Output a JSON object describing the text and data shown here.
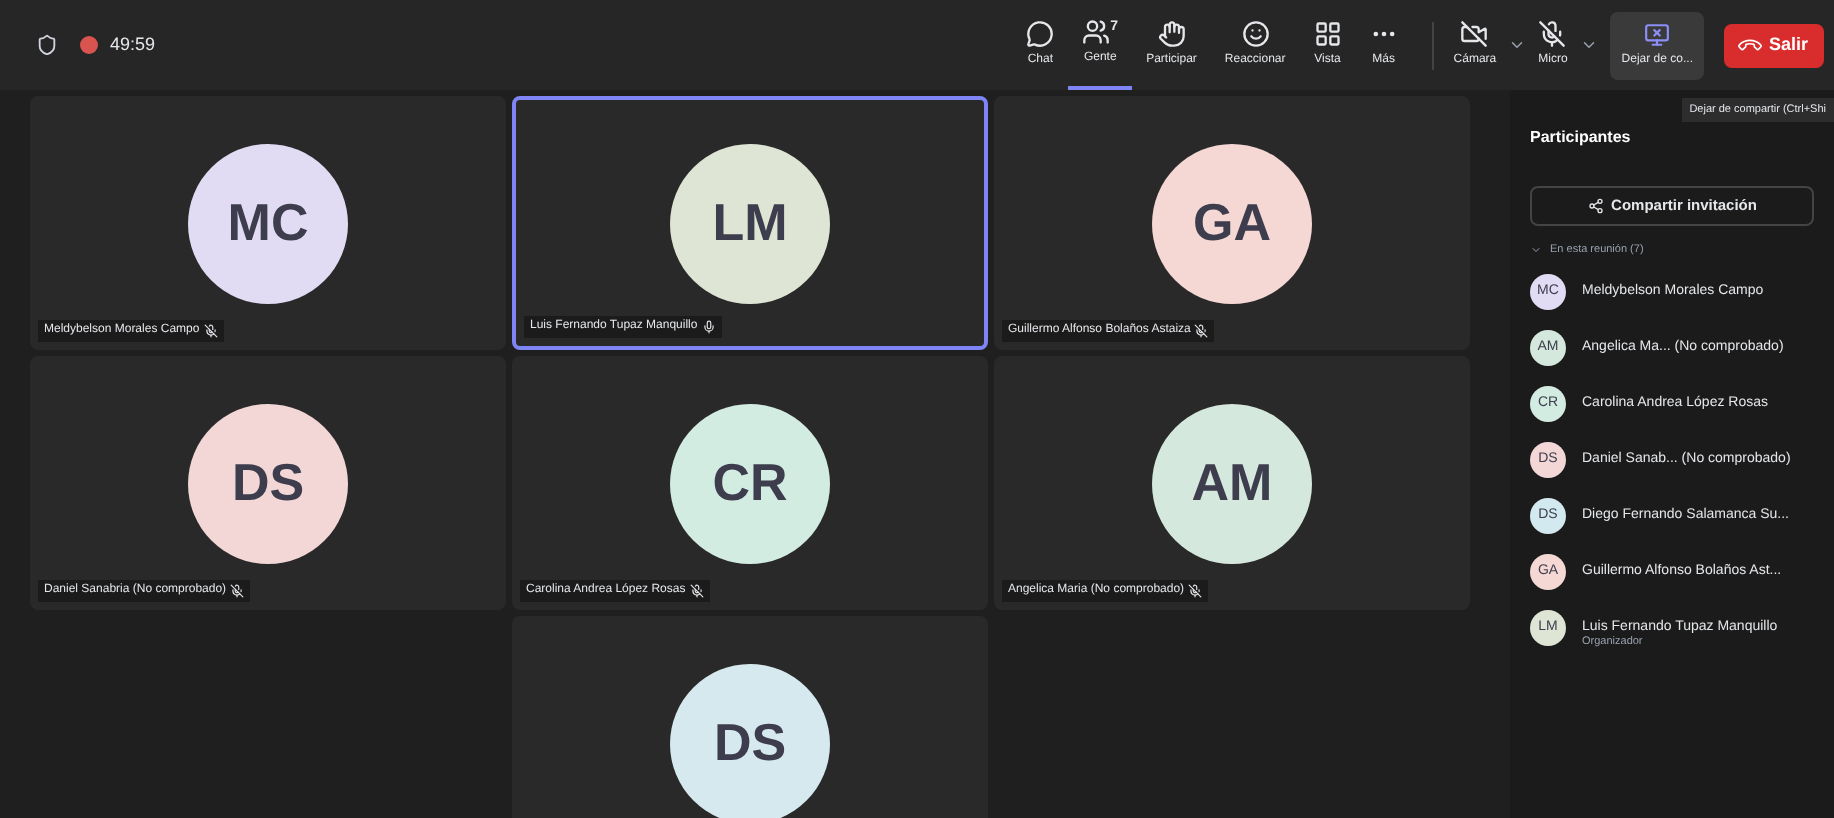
{
  "top_bar": {
    "timer": "49:59",
    "recording": true
  },
  "toolbar": [
    {
      "kind": "chat",
      "label": "Chat",
      "selected": false
    },
    {
      "kind": "people",
      "label": "Gente",
      "count": "7",
      "selected": true
    },
    {
      "kind": "hand",
      "label": "Participar",
      "selected": false
    },
    {
      "kind": "react",
      "label": "Reaccionar",
      "selected": false
    },
    {
      "kind": "view",
      "label": "Vista",
      "selected": false
    },
    {
      "kind": "more",
      "label": "Más",
      "selected": false
    }
  ],
  "devices": [
    {
      "kind": "camera",
      "label": "Cámara",
      "off": true
    },
    {
      "kind": "mic",
      "label": "Micro",
      "off": true
    }
  ],
  "share_button": {
    "label": "Dejar de co..."
  },
  "leave_button": {
    "label": "Salir"
  },
  "tooltip": "Dejar de compartir (Ctrl+Shi",
  "tiles": [
    {
      "initials": "MC",
      "name": "Meldybelson Morales Campo",
      "muted": true,
      "speaking": false,
      "color": "#e1dcf4"
    },
    {
      "initials": "LM",
      "name": "Luis Fernando Tupaz Manquillo",
      "muted": false,
      "speaking": true,
      "color": "#dfe5d5"
    },
    {
      "initials": "GA",
      "name": "Guillermo Alfonso Bolaños Astaiza",
      "muted": true,
      "speaking": false,
      "color": "#f5d7d3"
    },
    {
      "initials": "DS",
      "name": "Daniel Sanabria (No comprobado)",
      "muted": true,
      "speaking": false,
      "color": "#f3d7d7"
    },
    {
      "initials": "CR",
      "name": "Carolina Andrea López Rosas",
      "muted": true,
      "speaking": false,
      "color": "#d3ece2"
    },
    {
      "initials": "AM",
      "name": "Angelica Maria (No comprobado)",
      "muted": true,
      "speaking": false,
      "color": "#d5e8dd"
    },
    {
      "initials": "DS",
      "color": "#d6e9ee"
    }
  ],
  "panel": {
    "title": "Participantes",
    "invite_button": "Compartir invitación",
    "section": "En esta reunión (7)",
    "expanded": true,
    "participants": [
      {
        "initials": "MC",
        "name": "Meldybelson Morales Campo",
        "color": "#e1dcf4"
      },
      {
        "initials": "AM",
        "name": "Angelica Ma... (No comprobado)",
        "color": "#d5e8dd"
      },
      {
        "initials": "CR",
        "name": "Carolina Andrea López Rosas",
        "color": "#d3ece2"
      },
      {
        "initials": "DS",
        "name": "Daniel Sanab... (No comprobado)",
        "color": "#f3d7d7"
      },
      {
        "initials": "DS",
        "name": "Diego Fernando Salamanca Su...",
        "color": "#d3e9f0"
      },
      {
        "initials": "GA",
        "name": "Guillermo Alfonso Bolaños Ast...",
        "color": "#f5d7d3"
      },
      {
        "initials": "LM",
        "name": "Luis Fernando Tupaz Manquillo",
        "role": "Organizador",
        "color": "#dfe5d5"
      }
    ]
  }
}
